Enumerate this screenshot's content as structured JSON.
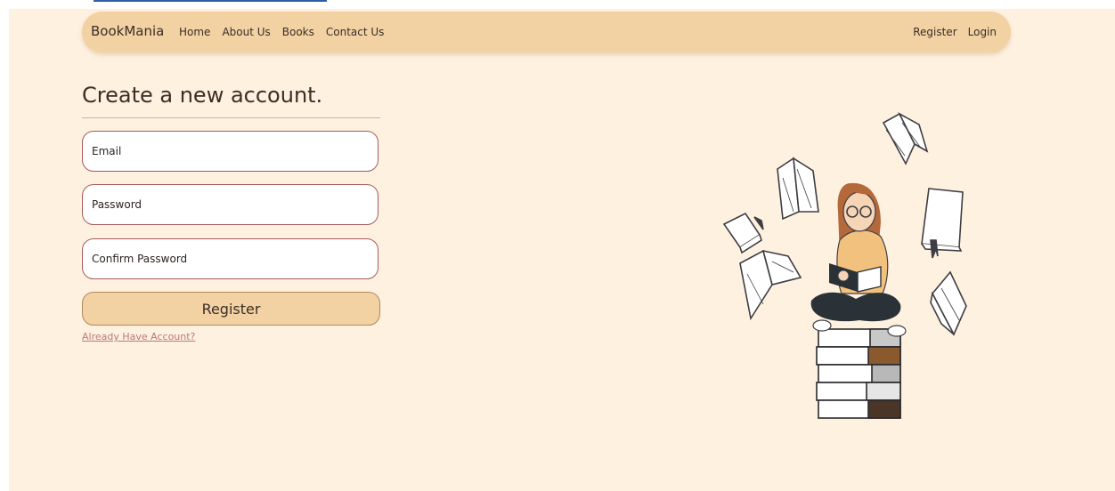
{
  "navbar": {
    "brand": "BookMania",
    "links": [
      "Home",
      "About Us",
      "Books",
      "Contact Us"
    ],
    "right_links": [
      "Register",
      "Login"
    ]
  },
  "form": {
    "title": "Create a new account.",
    "email_placeholder": "Email",
    "password_placeholder": "Password",
    "confirm_placeholder": "Confirm Password",
    "submit_label": "Register",
    "already_link": "Already Have Account?"
  },
  "colors": {
    "page_background": "#fff1df",
    "navbar": "#f2d1a3",
    "field_border": "#a85a5a",
    "link": "#b87878"
  },
  "illustration": {
    "name": "girl-reading-on-books-illustration"
  }
}
